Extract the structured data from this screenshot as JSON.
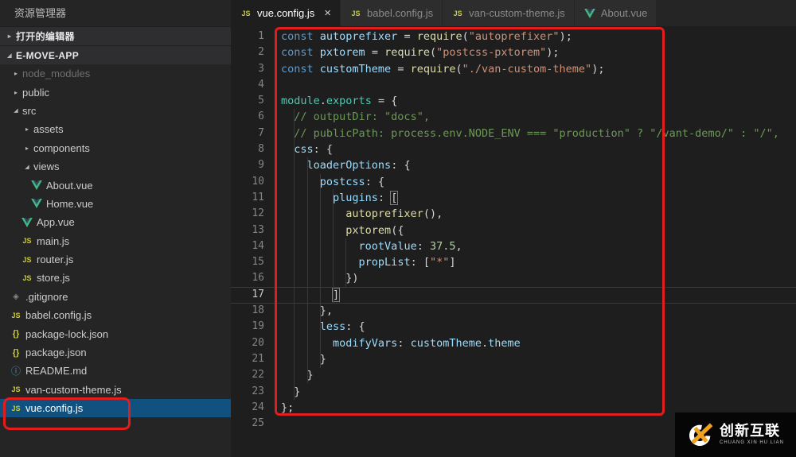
{
  "colors": {
    "annotation_red": "#e11d1d",
    "selection_blue": "#11517f",
    "vue_green": "#41b883",
    "js_yellow": "#cbcb41",
    "logo_orange": "#f0a01e"
  },
  "sidebar": {
    "title": "资源管理器",
    "sections": [
      {
        "label": "打开的编辑器",
        "expanded": false
      },
      {
        "label": "E-MOVE-APP",
        "expanded": true
      }
    ],
    "tree": [
      {
        "label": "node_modules",
        "icon": "folder-collapsed",
        "level": 0,
        "dim": true
      },
      {
        "label": "public",
        "icon": "folder-collapsed",
        "level": 0
      },
      {
        "label": "src",
        "icon": "folder-expanded",
        "level": 0
      },
      {
        "label": "assets",
        "icon": "folder-collapsed",
        "level": 1
      },
      {
        "label": "components",
        "icon": "folder-collapsed",
        "level": 1
      },
      {
        "label": "views",
        "icon": "folder-expanded",
        "level": 1
      },
      {
        "label": "About.vue",
        "icon": "vue",
        "level": 2
      },
      {
        "label": "Home.vue",
        "icon": "vue",
        "level": 2
      },
      {
        "label": "App.vue",
        "icon": "vue",
        "level": 1
      },
      {
        "label": "main.js",
        "icon": "js",
        "level": 1
      },
      {
        "label": "router.js",
        "icon": "js",
        "level": 1
      },
      {
        "label": "store.js",
        "icon": "js",
        "level": 1
      },
      {
        "label": ".gitignore",
        "icon": "git",
        "level": 0
      },
      {
        "label": "babel.config.js",
        "icon": "js",
        "level": 0
      },
      {
        "label": "package-lock.json",
        "icon": "json",
        "level": 0
      },
      {
        "label": "package.json",
        "icon": "json",
        "level": 0
      },
      {
        "label": "README.md",
        "icon": "info",
        "level": 0
      },
      {
        "label": "van-custom-theme.js",
        "icon": "js",
        "level": 0
      },
      {
        "label": "vue.config.js",
        "icon": "js",
        "level": 0,
        "selected": true
      }
    ]
  },
  "tabs": [
    {
      "label": "vue.config.js",
      "icon": "js",
      "active": true,
      "close_glyph": "×"
    },
    {
      "label": "babel.config.js",
      "icon": "js",
      "active": false
    },
    {
      "label": "van-custom-theme.js",
      "icon": "js",
      "active": false
    },
    {
      "label": "About.vue",
      "icon": "vue",
      "active": false
    }
  ],
  "editor": {
    "current_line": 17,
    "lines": [
      [
        [
          "const ",
          "kw"
        ],
        [
          "autoprefixer",
          "var"
        ],
        [
          " = ",
          "pun"
        ],
        [
          "require",
          "fn"
        ],
        [
          "(",
          "pun"
        ],
        [
          "\"autoprefixer\"",
          "str"
        ],
        [
          ");",
          "pun"
        ]
      ],
      [
        [
          "const ",
          "kw"
        ],
        [
          "pxtorem",
          "var"
        ],
        [
          " = ",
          "pun"
        ],
        [
          "require",
          "fn"
        ],
        [
          "(",
          "pun"
        ],
        [
          "\"postcss-pxtorem\"",
          "str"
        ],
        [
          ");",
          "pun"
        ]
      ],
      [
        [
          "const ",
          "kw"
        ],
        [
          "customTheme",
          "var"
        ],
        [
          " = ",
          "pun"
        ],
        [
          "require",
          "fn"
        ],
        [
          "(",
          "pun"
        ],
        [
          "\"./van-custom-theme\"",
          "str"
        ],
        [
          ");",
          "pun"
        ]
      ],
      [],
      [
        [
          "module",
          "mod"
        ],
        [
          ".",
          "pun"
        ],
        [
          "exports",
          "mod"
        ],
        [
          " = {",
          "pun"
        ]
      ],
      [
        [
          "  ",
          "pun"
        ],
        [
          "// outputDir: \"docs\",",
          "cmt"
        ]
      ],
      [
        [
          "  ",
          "pun"
        ],
        [
          "// publicPath: process.env.NODE_ENV === \"production\" ? \"/vant-demo/\" : \"/\",",
          "cmt"
        ]
      ],
      [
        [
          "  ",
          "pun"
        ],
        [
          "css",
          "var"
        ],
        [
          ": {",
          "pun"
        ]
      ],
      [
        [
          "    ",
          "pun"
        ],
        [
          "loaderOptions",
          "var"
        ],
        [
          ": {",
          "pun"
        ]
      ],
      [
        [
          "      ",
          "pun"
        ],
        [
          "postcss",
          "var"
        ],
        [
          ": {",
          "pun"
        ]
      ],
      [
        [
          "        ",
          "pun"
        ],
        [
          "plugins",
          "var"
        ],
        [
          ": ",
          "pun"
        ],
        [
          "[",
          "pun",
          "bm"
        ]
      ],
      [
        [
          "          ",
          "pun"
        ],
        [
          "autoprefixer",
          "fn"
        ],
        [
          "(),",
          "pun"
        ]
      ],
      [
        [
          "          ",
          "pun"
        ],
        [
          "pxtorem",
          "fn"
        ],
        [
          "({",
          "pun"
        ]
      ],
      [
        [
          "            ",
          "pun"
        ],
        [
          "rootValue",
          "var"
        ],
        [
          ": ",
          "pun"
        ],
        [
          "37.5",
          "num"
        ],
        [
          ",",
          "pun"
        ]
      ],
      [
        [
          "            ",
          "pun"
        ],
        [
          "propList",
          "var"
        ],
        [
          ": [",
          "pun"
        ],
        [
          "\"*\"",
          "str"
        ],
        [
          "]",
          "pun"
        ]
      ],
      [
        [
          "          })",
          "pun"
        ]
      ],
      [
        [
          "        ",
          "pun"
        ],
        [
          "]",
          "pun",
          "bm"
        ]
      ],
      [
        [
          "      },",
          "pun"
        ]
      ],
      [
        [
          "      ",
          "pun"
        ],
        [
          "less",
          "var"
        ],
        [
          ": {",
          "pun"
        ]
      ],
      [
        [
          "        ",
          "pun"
        ],
        [
          "modifyVars",
          "var"
        ],
        [
          ": ",
          "pun"
        ],
        [
          "customTheme",
          "var"
        ],
        [
          ".",
          "pun"
        ],
        [
          "theme",
          "var"
        ]
      ],
      [
        [
          "      }",
          "pun"
        ]
      ],
      [
        [
          "    }",
          "pun"
        ]
      ],
      [
        [
          "  }",
          "pun"
        ]
      ],
      [
        [
          "};",
          "pun"
        ]
      ],
      []
    ]
  },
  "watermark": {
    "brand": "创新互联",
    "sub": "CHUANG XIN HU LIAN"
  }
}
